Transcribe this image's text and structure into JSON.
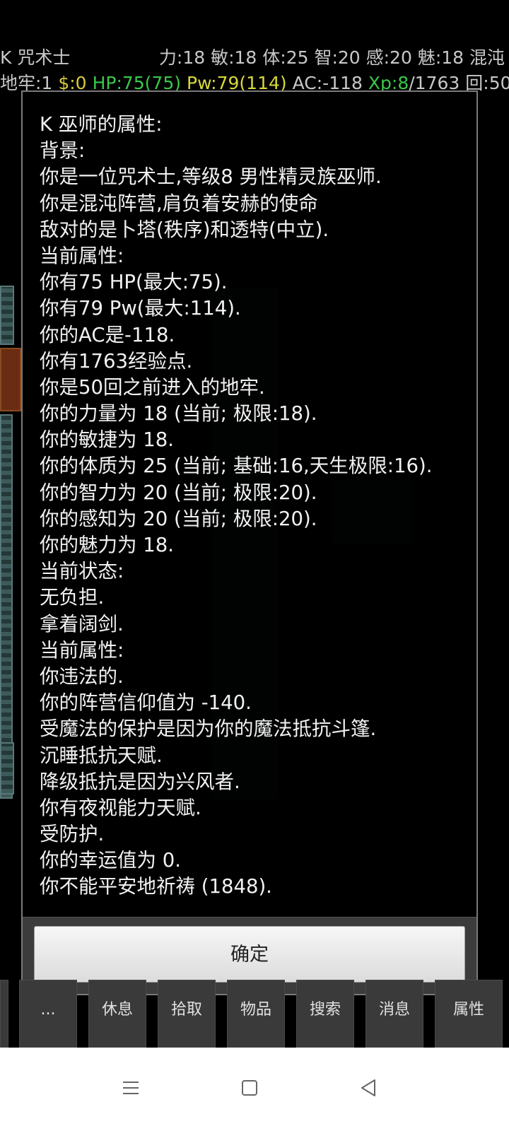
{
  "status": {
    "name": "K 咒术士",
    "attributes": "力:18 敏:18 体:25 智:20 感:20 魅:18 混沌",
    "dungeon": "地牢:1",
    "gold": "$:0",
    "hp": "HP:75(75)",
    "pw": "Pw:79(114)",
    "ac": "AC:-118",
    "xp": "Xp:8",
    "xp_rest": "/1763",
    "turn": "回:50"
  },
  "dialog": {
    "lines": [
      "K 巫师的属性:",
      "背景:",
      "你是一位咒术士,等级8 男性精灵族巫师.",
      "你是混沌阵营,肩负着安赫的使命",
      "敌对的是卜塔(秩序)和透特(中立).",
      "当前属性:",
      "你有75 HP(最大:75).",
      "你有79 Pw(最大:114).",
      "你的AC是-118.",
      "你有1763经验点.",
      "你是50回之前进入的地牢.",
      "你的力量为 18 (当前; 极限:18).",
      "你的敏捷为 18.",
      "你的体质为 25 (当前; 基础:16,天生极限:16).",
      "你的智力为 20 (当前; 极限:20).",
      "你的感知为 20 (当前; 极限:20).",
      "你的魅力为 18.",
      "当前状态:",
      "无负担.",
      "拿着阔剑.",
      "当前属性:",
      "你违法的.",
      "你的阵营信仰值为 -140.",
      "受魔法的保护是因为你的魔法抵抗斗篷.",
      "沉睡抵抗天赋.",
      "降级抵抗是因为兴风者.",
      "你有夜视能力天赋.",
      "受防护.",
      "你的幸运值为 0.",
      "你不能平安地祈祷 (1848)."
    ],
    "confirm_label": "确定"
  },
  "commands": [
    "...",
    "休息",
    "拾取",
    "物品",
    "搜索",
    "消息",
    "属性"
  ],
  "colors": {
    "gold": "#d6c93a",
    "hp": "#39c84a",
    "pw": "#d8d83a",
    "xp": "#39c84a"
  }
}
